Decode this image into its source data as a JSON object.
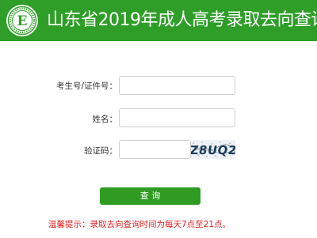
{
  "header": {
    "title": "山东省2019年成人高考录取去向查询",
    "logo_icon": "university-seal-logo",
    "background_color": "#2e9e28"
  },
  "form": {
    "id_label": "考生号/证件号：",
    "id_value": "",
    "name_label": "姓名：",
    "name_value": "",
    "captcha_label": "验证码：",
    "captcha_value": "",
    "captcha_text": "Z8UQ2"
  },
  "submit": {
    "label": "查 询",
    "color": "#2f9b22"
  },
  "notice": {
    "text": "温馨提示：录取去向查询时间为每天7点至21点。",
    "color": "#e02020"
  }
}
